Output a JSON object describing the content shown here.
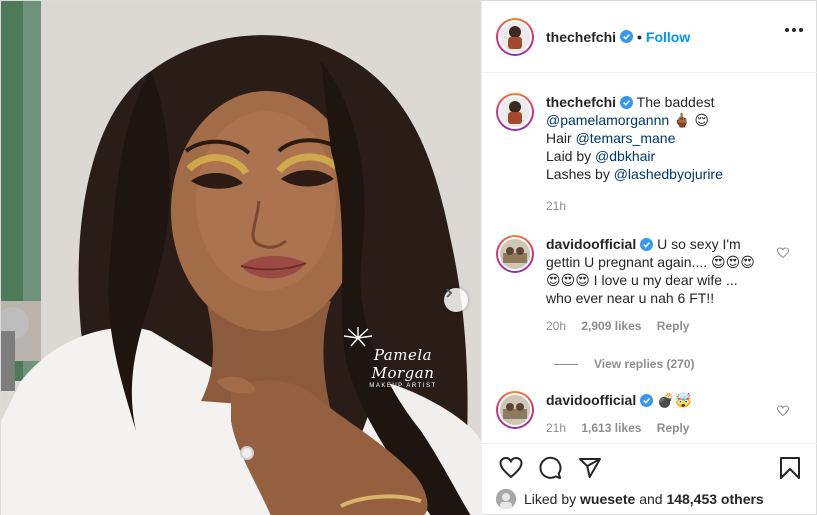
{
  "photo": {
    "watermark_name": "Pamela Morgan",
    "watermark_sub": "MAKEUP ARTIST"
  },
  "header": {
    "username": "thechefchi",
    "separator": "•",
    "follow_label": "Follow"
  },
  "caption": {
    "username": "thechefchi",
    "first_line_text": "The baddest",
    "mention_1": "@pamelamorgannn",
    "emoji_1": "🖕🏾 😌",
    "hair_label": "Hair",
    "mention_2": "@temars_mane",
    "laid_label": "Laid by",
    "mention_3": "@dbkhair",
    "lashes_label": "Lashes by",
    "mention_4": "@lashedbyojurire",
    "time": "21h"
  },
  "comments": [
    {
      "username": "davidoofficial",
      "text": "U so sexy I'm gettin U pregnant again.... 😍😍😍😍😍😍 I love u my dear wife ... who ever near u nah 6 FT!!",
      "time": "20h",
      "likes": "2,909 likes",
      "reply_label": "Reply",
      "view_replies": "View replies (270)"
    },
    {
      "username": "davidoofficial",
      "text": "💣🤯",
      "time": "21h",
      "likes": "1,613 likes",
      "reply_label": "Reply"
    }
  ],
  "footer": {
    "liked_prefix": "Liked by",
    "liked_user": "wuesete",
    "liked_and": "and",
    "liked_others": "148,453 others"
  },
  "colors": {
    "accent": "#0095f6",
    "mention": "#00376b",
    "muted": "#8e8e8e",
    "text": "#262626"
  },
  "icons": [
    "verified-icon",
    "more-icon",
    "heart-icon",
    "comment-icon",
    "share-icon",
    "bookmark-icon",
    "chevron-right-icon"
  ]
}
